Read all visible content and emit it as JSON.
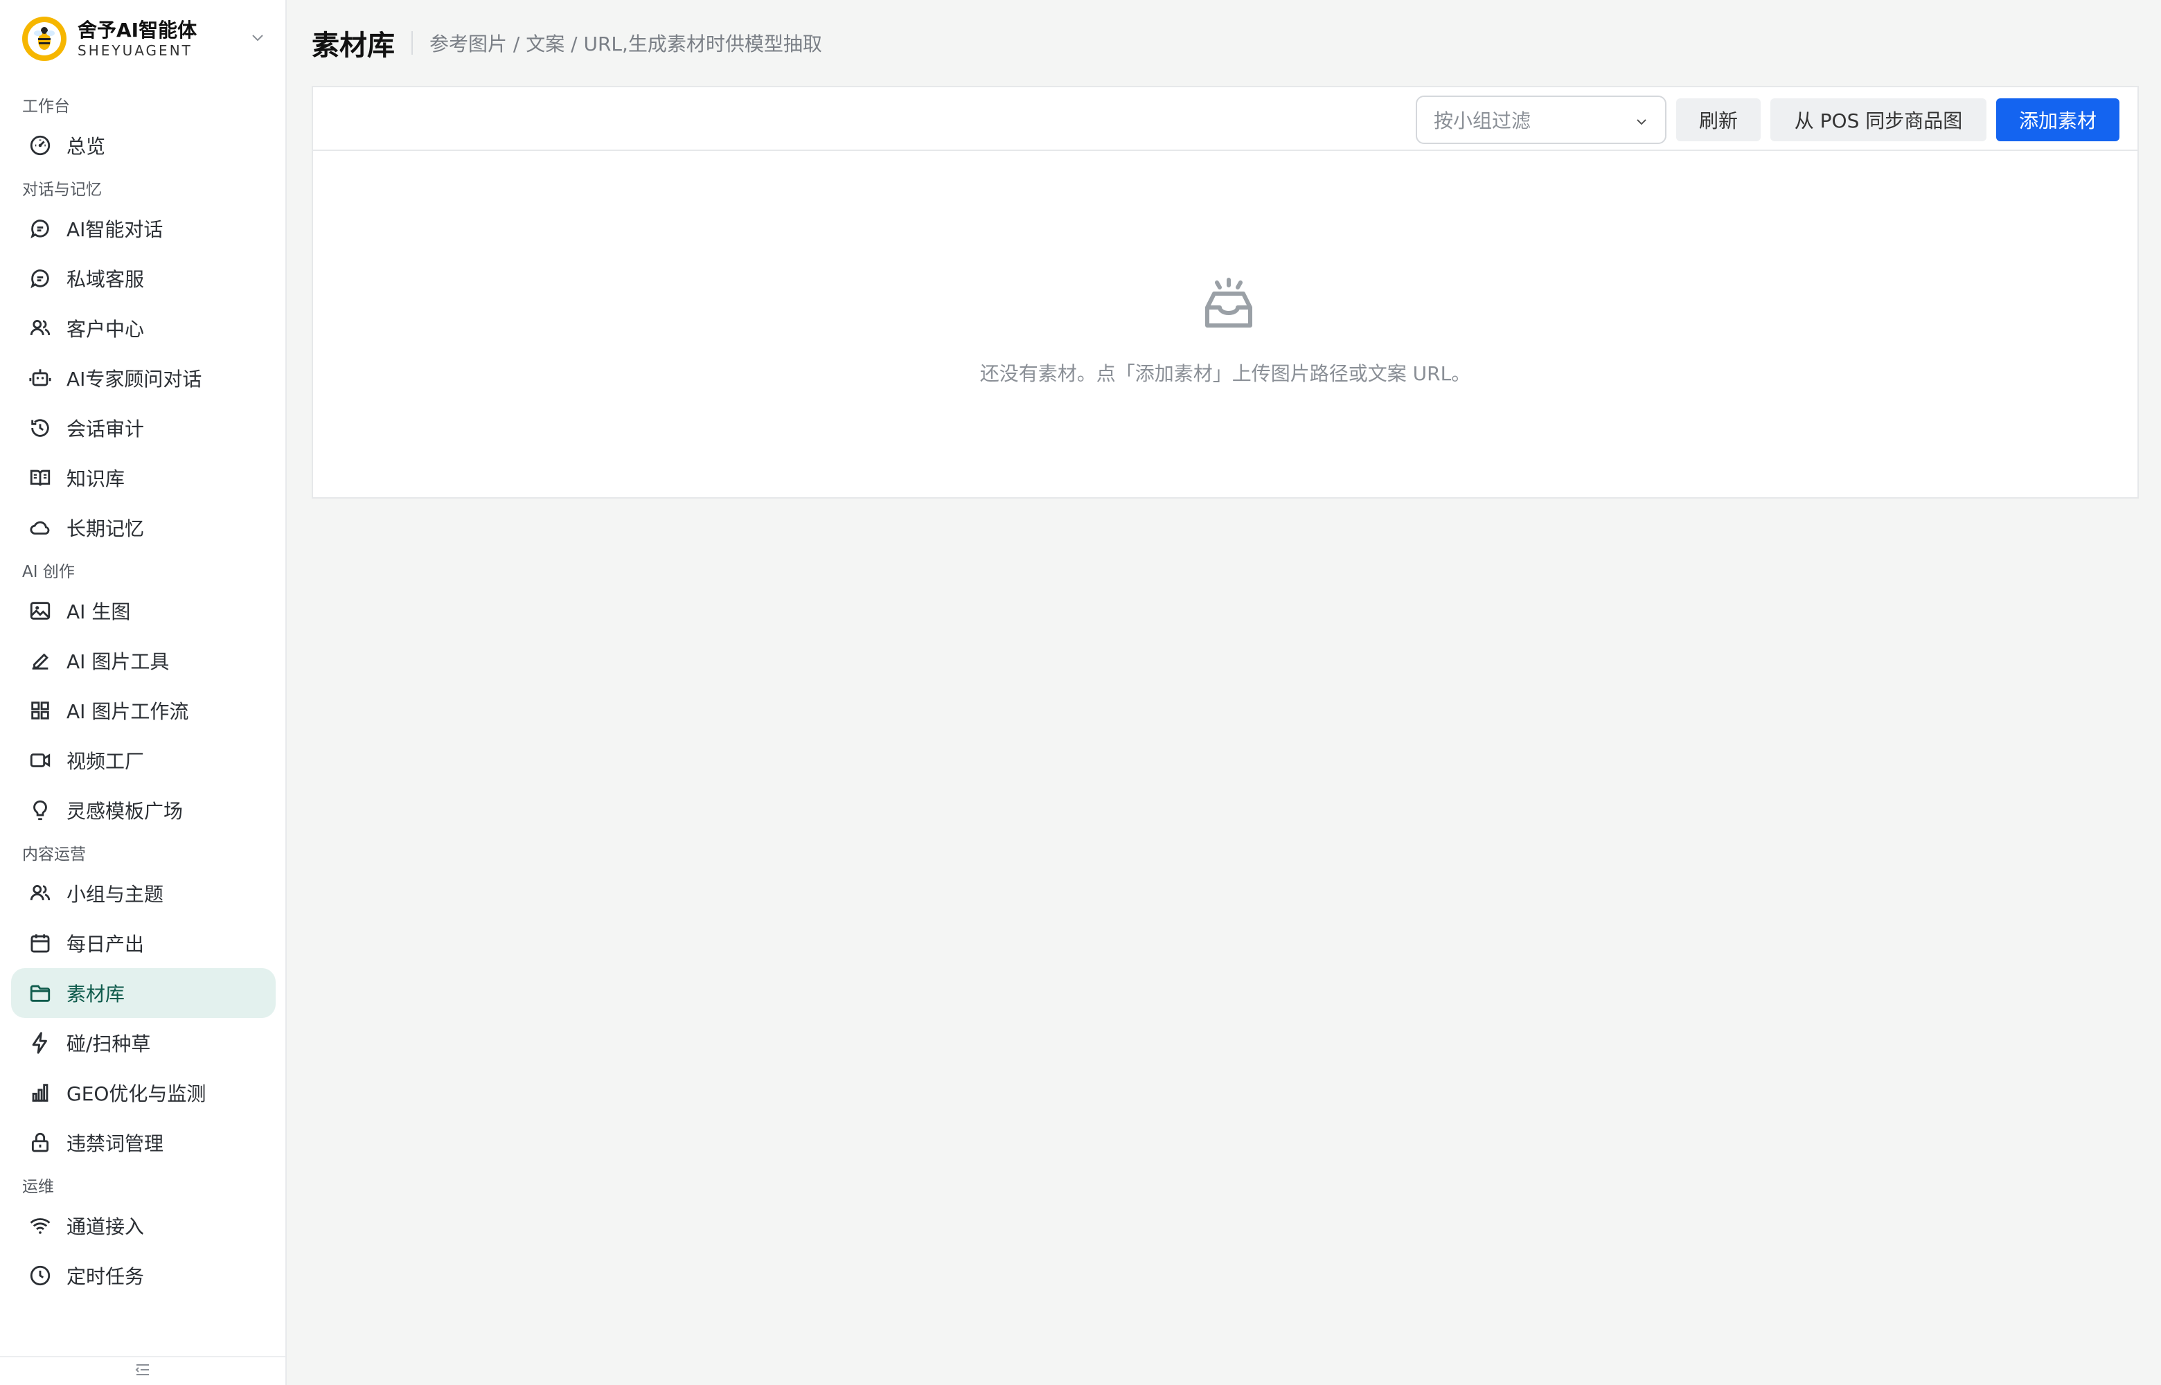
{
  "brand": {
    "name": "舍予AI智能体",
    "subtitle": "SHEYUAGENT",
    "accent": "#f6b600"
  },
  "sidebar": {
    "sections": [
      {
        "title": "工作台",
        "items": [
          {
            "label": "总览",
            "icon": "dashboard-icon"
          }
        ]
      },
      {
        "title": "对话与记忆",
        "items": [
          {
            "label": "AI智能对话",
            "icon": "chat-icon"
          },
          {
            "label": "私域客服",
            "icon": "chat-icon"
          },
          {
            "label": "客户中心",
            "icon": "users-icon"
          },
          {
            "label": "AI专家顾问对话",
            "icon": "robot-icon"
          },
          {
            "label": "会话审计",
            "icon": "history-icon"
          },
          {
            "label": "知识库",
            "icon": "book-icon"
          },
          {
            "label": "长期记忆",
            "icon": "cloud-icon"
          }
        ]
      },
      {
        "title": "AI 创作",
        "items": [
          {
            "label": "AI 生图",
            "icon": "image-icon"
          },
          {
            "label": "AI 图片工具",
            "icon": "pen-icon"
          },
          {
            "label": "AI 图片工作流",
            "icon": "grid-icon"
          },
          {
            "label": "视频工厂",
            "icon": "video-icon"
          },
          {
            "label": "灵感模板广场",
            "icon": "lightbulb-icon"
          }
        ]
      },
      {
        "title": "内容运营",
        "items": [
          {
            "label": "小组与主题",
            "icon": "users-icon"
          },
          {
            "label": "每日产出",
            "icon": "calendar-icon"
          },
          {
            "label": "素材库",
            "icon": "folder-icon",
            "active": true
          },
          {
            "label": "碰/扫种草",
            "icon": "bolt-icon"
          },
          {
            "label": "GEO优化与监测",
            "icon": "bar-chart-icon"
          },
          {
            "label": "违禁词管理",
            "icon": "lock-icon"
          }
        ]
      },
      {
        "title": "运维",
        "items": [
          {
            "label": "通道接入",
            "icon": "wifi-icon"
          },
          {
            "label": "定时任务",
            "icon": "clock-icon"
          }
        ]
      }
    ]
  },
  "header": {
    "title": "素材库",
    "subtitle": "参考图片 / 文案 / URL,生成素材时供模型抽取"
  },
  "toolbar": {
    "filter_placeholder": "按小组过滤",
    "refresh_label": "刷新",
    "sync_label": "从 POS 同步商品图",
    "add_label": "添加素材",
    "primary_color": "#1464f0"
  },
  "empty": {
    "message": "还没有素材。点「添加素材」上传图片路径或文案 URL。",
    "icon": "inbox-icon"
  }
}
